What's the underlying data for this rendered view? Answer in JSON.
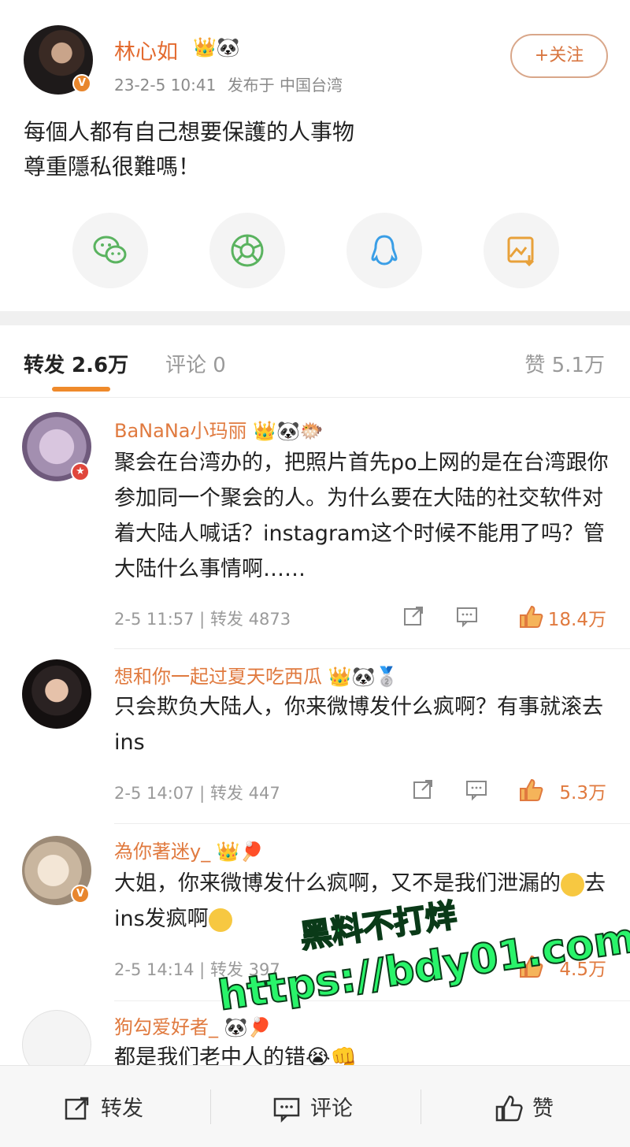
{
  "post": {
    "author": "林心如",
    "verified_badge": "V",
    "badges": "👑🐼",
    "timestamp": "23-2-5 10:41",
    "location": "发布于 中国台湾",
    "follow_label": "+关注",
    "text": "每個人都有自己想要保護的人事物\n尊重隱私很難嗎！",
    "share_icons": [
      "wechat-icon",
      "moments-icon",
      "qq-icon",
      "save-image-icon"
    ]
  },
  "tabs": {
    "repost": "转发 2.6万",
    "comment": "评论 0",
    "like": "赞 5.1万"
  },
  "comments": [
    {
      "name": "BaNaNa小玛丽",
      "badges": "👑🐼🐡",
      "text": "聚会在台湾办的，把照片首先po上网的是在台湾跟你参加同一个聚会的人。为什么要在大陆的社交软件对着大陆人喊话？instagram这个时候不能用了吗？管大陆什么事情啊……",
      "time": "2-5 11:57",
      "repost": "转发 4873",
      "likes": "18.4万"
    },
    {
      "name": "想和你一起过夏天吃西瓜",
      "badges": "👑🐼🥈",
      "text": "只会欺负大陆人，你来微博发什么疯啊？有事就滚去ins",
      "time": "2-5 14:07",
      "repost": "转发 447",
      "likes": "5.3万"
    },
    {
      "name": "為你著迷y_",
      "badges": "👑🏓",
      "text_a": "大姐，你来微博发什么疯啊，又不是我们泄漏的",
      "text_b": "去ins发疯啊",
      "time": "2-5 14:14",
      "repost": "转发 397",
      "likes": "4.5万"
    },
    {
      "name": "狗勾爱好者_",
      "badges": "🐼🏓",
      "text": "都是我们老中人的错",
      "text_emoji": "😭👊"
    }
  ],
  "watermark": {
    "line1": "黑料不打烊",
    "line2": "https://bdy01.com"
  },
  "bottom_bar": {
    "repost": "转发",
    "comment": "评论",
    "like": "赞"
  },
  "colors": {
    "accent": "#e07a3f",
    "tab_underline": "#ef8a2b",
    "watermark": "#29f46a"
  }
}
